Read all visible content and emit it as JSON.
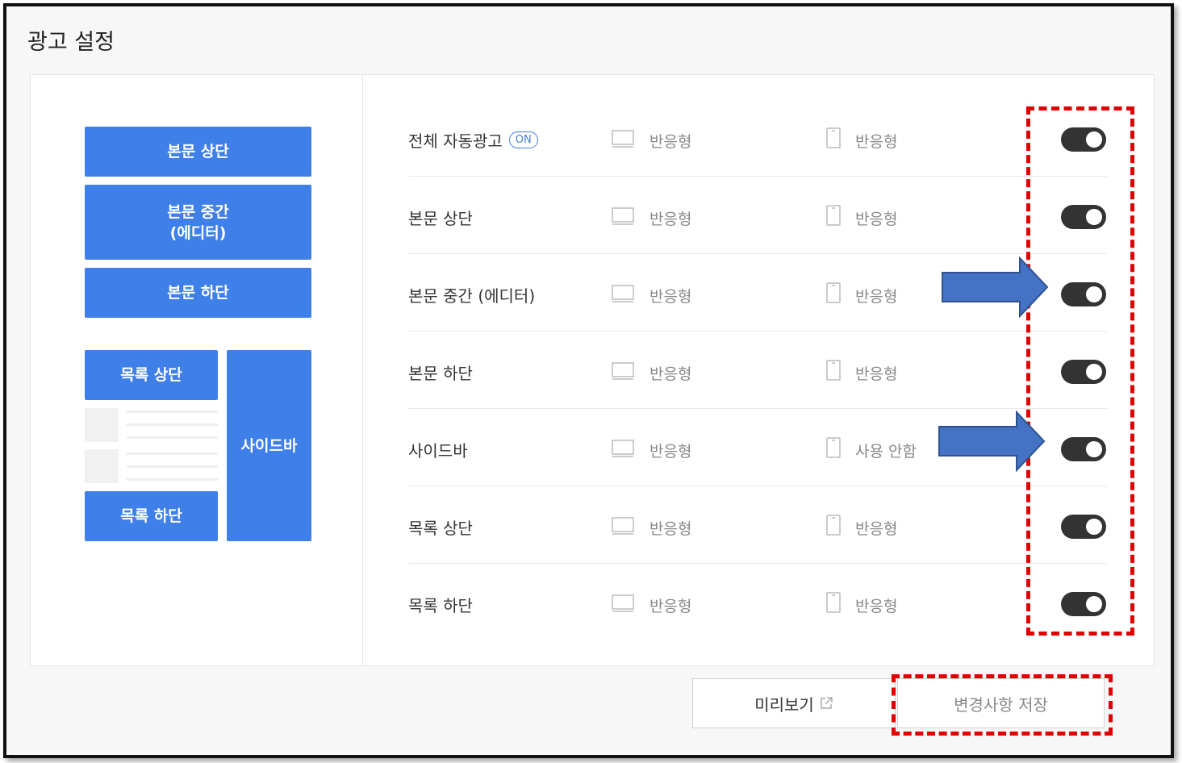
{
  "page": {
    "title": "광고 설정"
  },
  "preview": {
    "body_top": "본문 상단",
    "body_middle_line1": "본문 중간",
    "body_middle_line2": "(에디터)",
    "body_bottom": "본문 하단",
    "list_top": "목록 상단",
    "list_bottom": "목록 하단",
    "sidebar": "사이드바"
  },
  "rows": [
    {
      "label": "전체 자동광고",
      "badge": "ON",
      "pc": "반응형",
      "mobile": "반응형",
      "enabled": true
    },
    {
      "label": "본문 상단",
      "pc": "반응형",
      "mobile": "반응형",
      "enabled": true
    },
    {
      "label": "본문 중간 (에디터)",
      "pc": "반응형",
      "mobile": "반응형",
      "enabled": true
    },
    {
      "label": "본문 하단",
      "pc": "반응형",
      "mobile": "반응형",
      "enabled": true
    },
    {
      "label": "사이드바",
      "pc": "반응형",
      "mobile": "사용 안함",
      "enabled": true
    },
    {
      "label": "목록 상단",
      "pc": "반응형",
      "mobile": "반응형",
      "enabled": true
    },
    {
      "label": "목록 하단",
      "pc": "반응형",
      "mobile": "반응형",
      "enabled": true
    }
  ],
  "footer": {
    "preview_label": "미리보기",
    "save_label": "변경사항 저장"
  },
  "colors": {
    "accent": "#3f7fe8",
    "toggle_on": "#333333",
    "annotation_red": "#e00000",
    "annotation_arrow": "#4472c4"
  }
}
